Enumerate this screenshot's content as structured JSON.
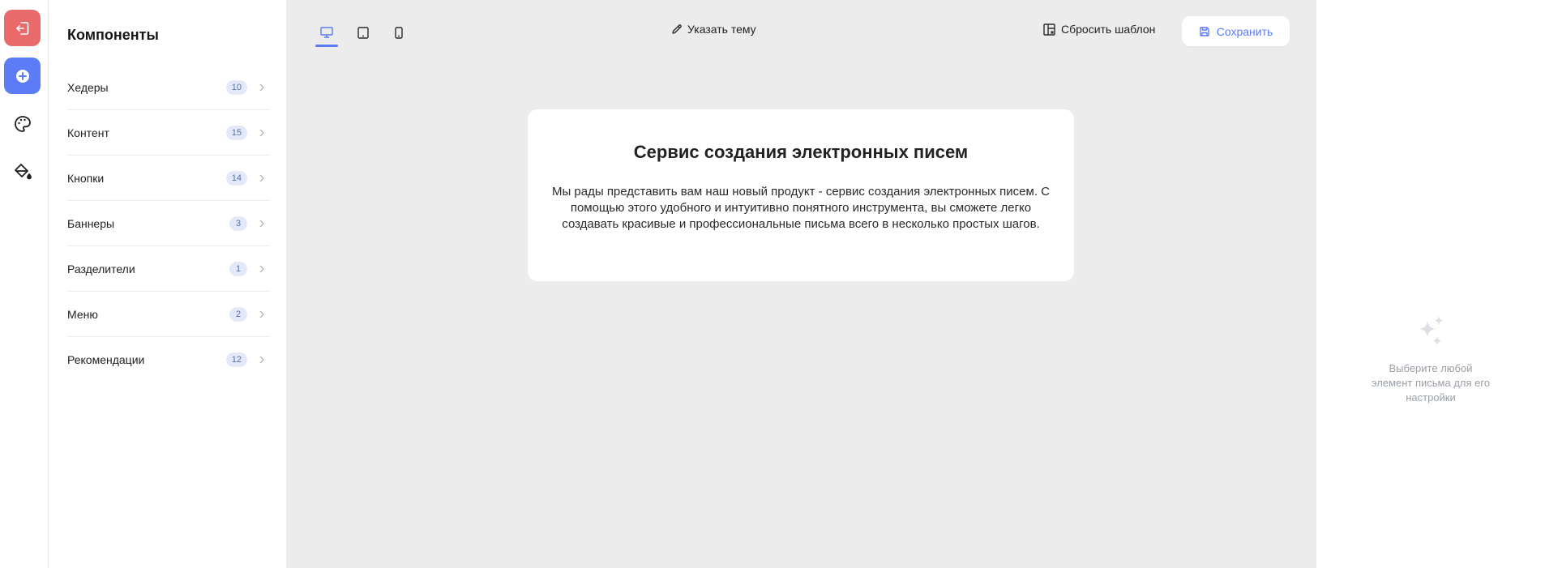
{
  "rail": {
    "items": [
      {
        "name": "exit",
        "icon": "exit-icon",
        "color": "#e96a6a"
      },
      {
        "name": "add",
        "icon": "plus-circle-icon",
        "color": "#5b7cf6"
      },
      {
        "name": "palette",
        "icon": "palette-icon"
      },
      {
        "name": "fill",
        "icon": "paint-bucket-icon"
      }
    ]
  },
  "components": {
    "title": "Компоненты",
    "items": [
      {
        "label": "Хедеры",
        "count": "10"
      },
      {
        "label": "Контент",
        "count": "15"
      },
      {
        "label": "Кнопки",
        "count": "14"
      },
      {
        "label": "Баннеры",
        "count": "3"
      },
      {
        "label": "Разделители",
        "count": "1"
      },
      {
        "label": "Меню",
        "count": "2"
      },
      {
        "label": "Рекомендации",
        "count": "12"
      }
    ]
  },
  "toolbar": {
    "devices": [
      {
        "name": "desktop",
        "icon": "desktop-icon",
        "active": true
      },
      {
        "name": "tablet",
        "icon": "tablet-icon",
        "active": false
      },
      {
        "name": "mobile",
        "icon": "mobile-icon",
        "active": false
      }
    ],
    "theme_label": "Указать тему",
    "reset_label": "Сбросить шаблон",
    "save_label": "Сохранить"
  },
  "email": {
    "title": "Сервис создания электронных писем",
    "text": "Мы рады представить вам наш новый продукт - сервис создания электронных писем. С помощью этого удобного и интуитивно понятного инструмента, вы сможете легко создавать красивые и профессиональные письма всего в несколько простых шагов."
  },
  "settings": {
    "hint": "Выберите любой элемент письма для его настройки",
    "icon": "sparkles-icon"
  },
  "colors": {
    "accent": "#5b7cf6",
    "danger": "#e96a6a",
    "canvas_bg": "#ececec",
    "badge_bg": "#e3e9fb"
  }
}
